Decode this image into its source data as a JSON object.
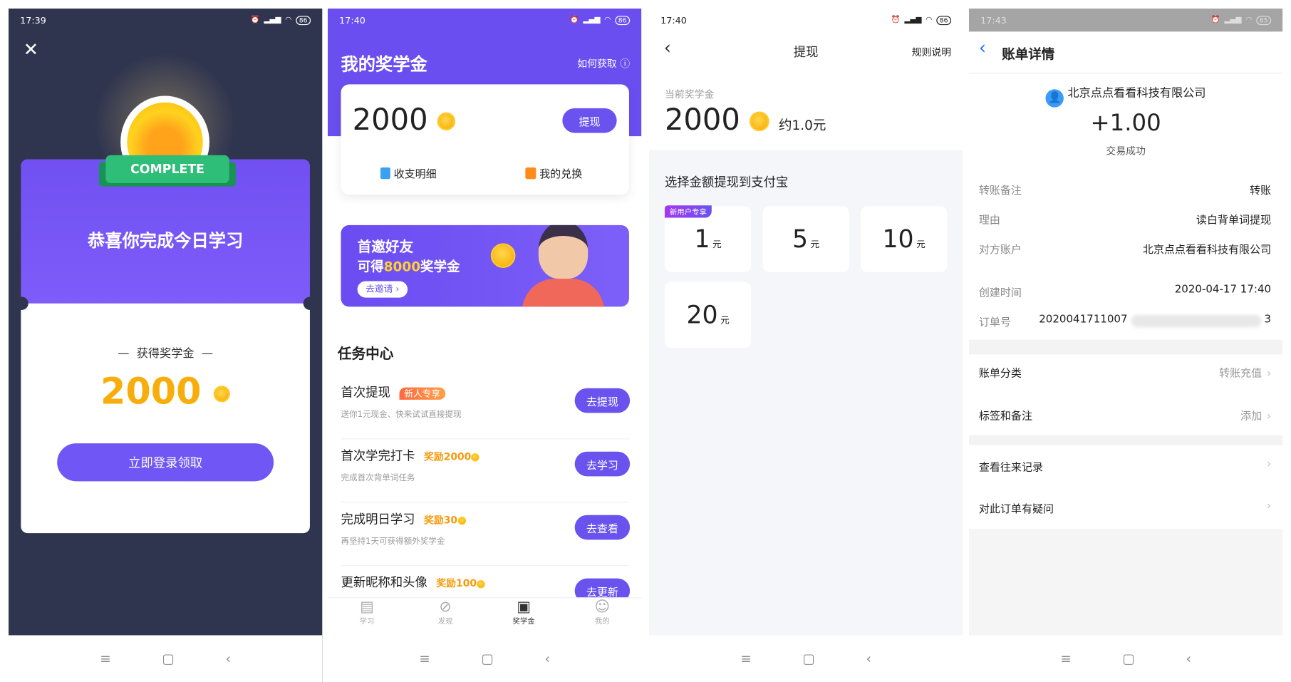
{
  "panel1": {
    "time": "17:39",
    "battery": "86",
    "badge": "COMPLETE",
    "title": "恭喜你完成今日学习",
    "reward_label": "获得奖学金",
    "reward_amount": "2000",
    "login_button": "立即登录领取"
  },
  "panel2": {
    "time": "17:40",
    "battery": "86",
    "title": "我的奖学金",
    "how_to_get": "如何获取",
    "balance": "2000",
    "withdraw_button": "提现",
    "links": [
      {
        "label": "收支明细",
        "icon": "ledger-icon"
      },
      {
        "label": "我的兑换",
        "icon": "gift-icon"
      }
    ],
    "banner": {
      "line1": "首邀好友",
      "line2_prefix": "可得",
      "line2_amount": "8000",
      "line2_suffix": "奖学金",
      "button": "去邀请 ›"
    },
    "tasks_title": "任务中心",
    "tasks": [
      {
        "title": "首次提现",
        "tag": "新人专享",
        "reward": "",
        "desc": "送你1元现金、快来试试直接提现",
        "button": "去提现"
      },
      {
        "title": "首次学完打卡",
        "tag": "",
        "reward": "奖励2000",
        "desc": "完成首次背单词任务",
        "button": "去学习"
      },
      {
        "title": "完成明日学习",
        "tag": "",
        "reward": "奖励30",
        "desc": "再坚持1天可获得额外奖学金",
        "button": "去查看"
      },
      {
        "title": "更新昵称和头像",
        "tag": "",
        "reward": "奖励100",
        "desc": "",
        "button": "去更新"
      }
    ],
    "tabs": [
      {
        "label": "学习",
        "icon": "calendar-icon",
        "active": false
      },
      {
        "label": "发现",
        "icon": "discover-icon",
        "active": false
      },
      {
        "label": "奖学金",
        "icon": "wallet-icon",
        "active": true
      },
      {
        "label": "我的",
        "icon": "profile-icon",
        "active": false
      }
    ]
  },
  "panel3": {
    "time": "17:40",
    "battery": "86",
    "title": "提现",
    "rules": "规则说明",
    "current_label": "当前奖学金",
    "balance": "2000",
    "approx": "约1.0元",
    "choose_label": "选择金额提现到支付宝",
    "new_user_badge": "新用户专享",
    "unit": "元",
    "options": [
      "1",
      "5",
      "10",
      "20"
    ]
  },
  "panel4": {
    "time": "17:43",
    "battery": "85",
    "title": "账单详情",
    "payee": "北京点点看看科技有限公司",
    "amount": "+1.00",
    "status": "交易成功",
    "details": [
      {
        "label": "转账备注",
        "value": "转账"
      },
      {
        "label": "理由",
        "value": "读白背单词提现"
      },
      {
        "label": "对方账户",
        "value": "北京点点看看科技有限公司"
      },
      {
        "label": "创建时间",
        "value": "2020-04-17 17:40"
      }
    ],
    "order_label": "订单号",
    "order_prefix": "2020041711007",
    "order_suffix": "3",
    "category_label": "账单分类",
    "category_value": "转账充值",
    "tags_label": "标签和备注",
    "tags_value": "添加",
    "history": "查看往来记录",
    "question": "对此订单有疑问"
  },
  "colors": {
    "primary": "#6a52ef",
    "dark_bg": "#30354f",
    "gold": "#f6a800",
    "green": "#22b26a",
    "link_blue": "#1677ff"
  }
}
